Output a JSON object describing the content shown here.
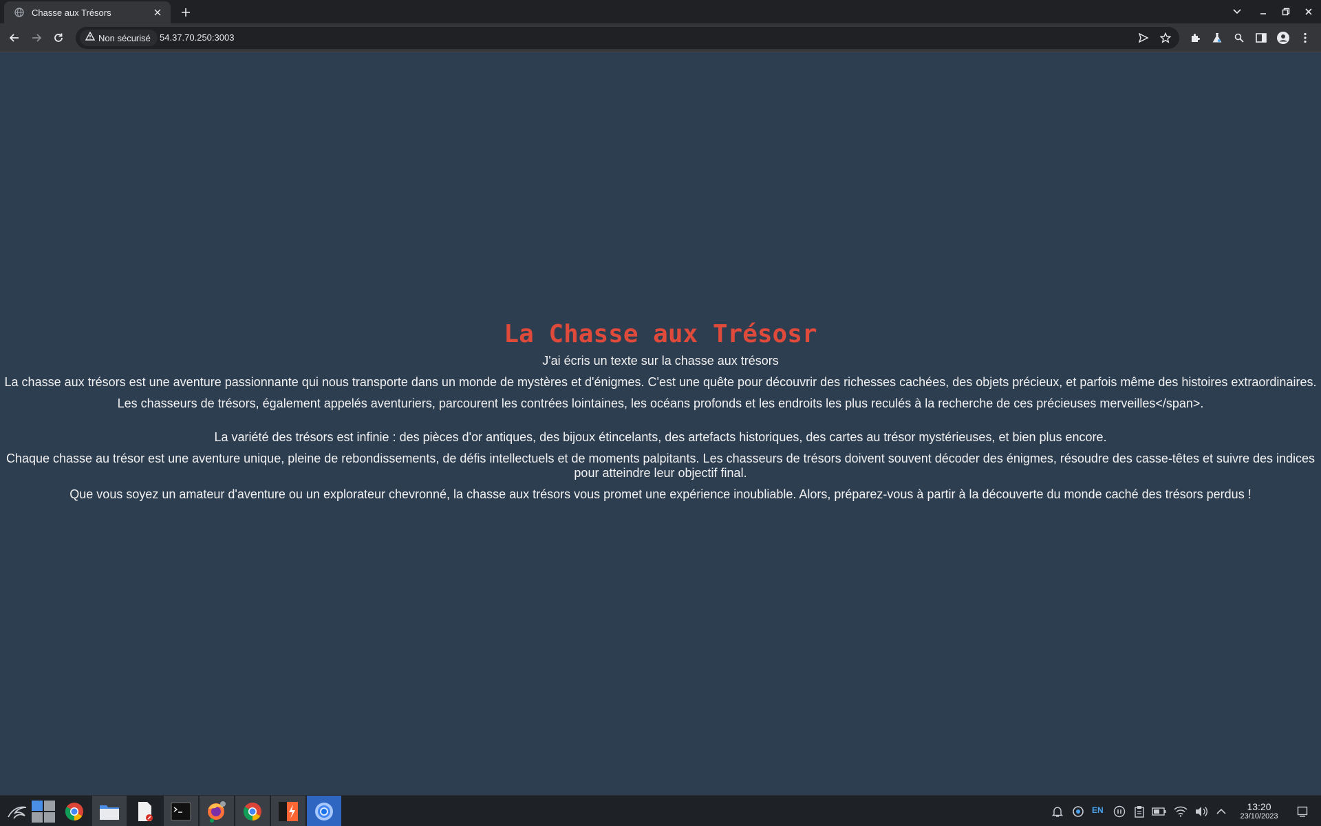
{
  "browser": {
    "tab_title": "Chasse aux Trésors",
    "security_label": "Non sécurisé",
    "url": "54.37.70.250:3003"
  },
  "page": {
    "heading": "La Chasse aux Trésosr",
    "subtitle": "J'ai écris un texte sur la chasse aux trésors",
    "paragraphs": [
      "La chasse aux trésors est une aventure passionnante qui nous transporte dans un monde de mystères et d'énigmes. C'est une quête pour découvrir des richesses cachées, des objets précieux, et parfois même des histoires extraordinaires.",
      "Les chasseurs de trésors, également appelés aventuriers, parcourent les contrées lointaines, les océans profonds et les endroits les plus reculés à la recherche de ces précieuses merveilles</span>.",
      "La variété des trésors est infinie : des pièces d'or antiques, des bijoux étincelants, des artefacts historiques, des cartes au trésor mystérieuses, et bien plus encore.",
      "Chaque chasse au trésor est une aventure unique, pleine de rebondissements, de défis intellectuels et de moments palpitants. Les chasseurs de trésors doivent souvent décoder des énigmes, résoudre des casse-têtes et suivre des indices pour atteindre leur objectif final.",
      "Que vous soyez un amateur d'aventure ou un explorateur chevronné, la chasse aux trésors vous promet une expérience inoubliable. Alors, préparez-vous à partir à la découverte du monde caché des trésors perdus !"
    ],
    "colors": {
      "background": "#2e3e51",
      "heading": "#e04a3b",
      "text": "#f1f1f1"
    }
  },
  "taskbar": {
    "apps": [
      "kali-menu-icon",
      "workspaces-icon",
      "chrome-icon",
      "file-manager-icon",
      "text-editor-icon",
      "terminal-icon",
      "firefox-icon",
      "chrome-icon",
      "burpsuite-icon",
      "chromium-icon"
    ],
    "tray_language": "EN",
    "clock_time": "13:20",
    "clock_date": "23/10/2023"
  }
}
